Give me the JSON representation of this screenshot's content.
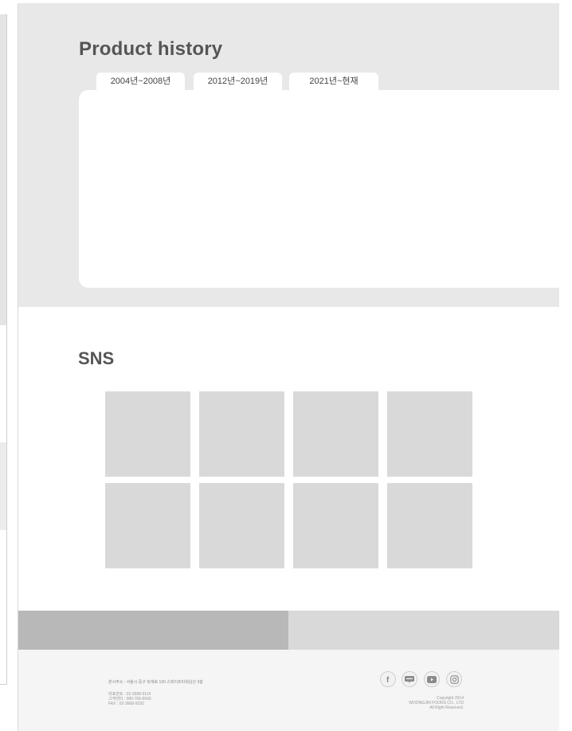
{
  "history": {
    "title": "Product history",
    "tabs": [
      {
        "label": "2004년~2008년"
      },
      {
        "label": "2012년~2019년"
      },
      {
        "label": "2021년~현재"
      }
    ]
  },
  "sns": {
    "title": "SNS",
    "tile_count": 8
  },
  "footer": {
    "address": "본사주소 : 서울시 중구 퇴계로 100 스테이트타워남산 3층",
    "contacts": [
      "대표번호 : 02-3668-9114",
      "고객센터 : 080-766-6543",
      "FAX : 02-3668-9292"
    ],
    "social_icons": [
      "facebook-icon",
      "blog-icon",
      "youtube-icon",
      "instagram-icon"
    ],
    "copyright": [
      "Copyright 2014",
      "WOONGJIN FOODS CO., LTD",
      "All Right Reserved."
    ]
  },
  "colors": {
    "history_bg": "#e8e8e8",
    "band_dark": "#b8b8b8",
    "band_light": "#d9d9d9",
    "tile": "#d9d9d9",
    "footer_bg": "#f5f5f5"
  }
}
